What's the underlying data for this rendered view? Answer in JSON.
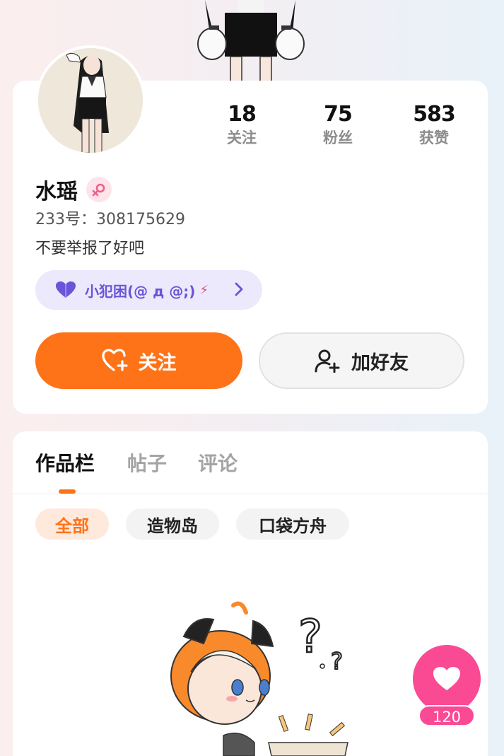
{
  "profile": {
    "name": "水瑶",
    "uid": "233号：308175629",
    "bio": "不要举报了好吧",
    "tag": "小犯困(@ д @;)"
  },
  "stats": [
    {
      "value": "18",
      "label": "关注"
    },
    {
      "value": "75",
      "label": "粉丝"
    },
    {
      "value": "583",
      "label": "获赞"
    }
  ],
  "actions": {
    "follow_label": "关注",
    "add_friend_label": "加好友"
  },
  "tabs": [
    {
      "label": "作品栏",
      "active": true
    },
    {
      "label": "帖子",
      "active": false
    },
    {
      "label": "评论",
      "active": false
    }
  ],
  "filters": [
    {
      "label": "全部",
      "active": true
    },
    {
      "label": "造物岛",
      "active": false
    },
    {
      "label": "口袋方舟",
      "active": false
    }
  ],
  "like": {
    "count": "120"
  },
  "icons": {
    "gender": "female-icon",
    "tag": "heart-icon",
    "follow": "heart-plus-icon",
    "friend": "user-plus-icon",
    "chevron": "chevron-right-icon",
    "like": "heart-icon"
  },
  "colors": {
    "accent": "#fe7318",
    "like": "#fa4a94",
    "tag": "#6b54d8"
  }
}
